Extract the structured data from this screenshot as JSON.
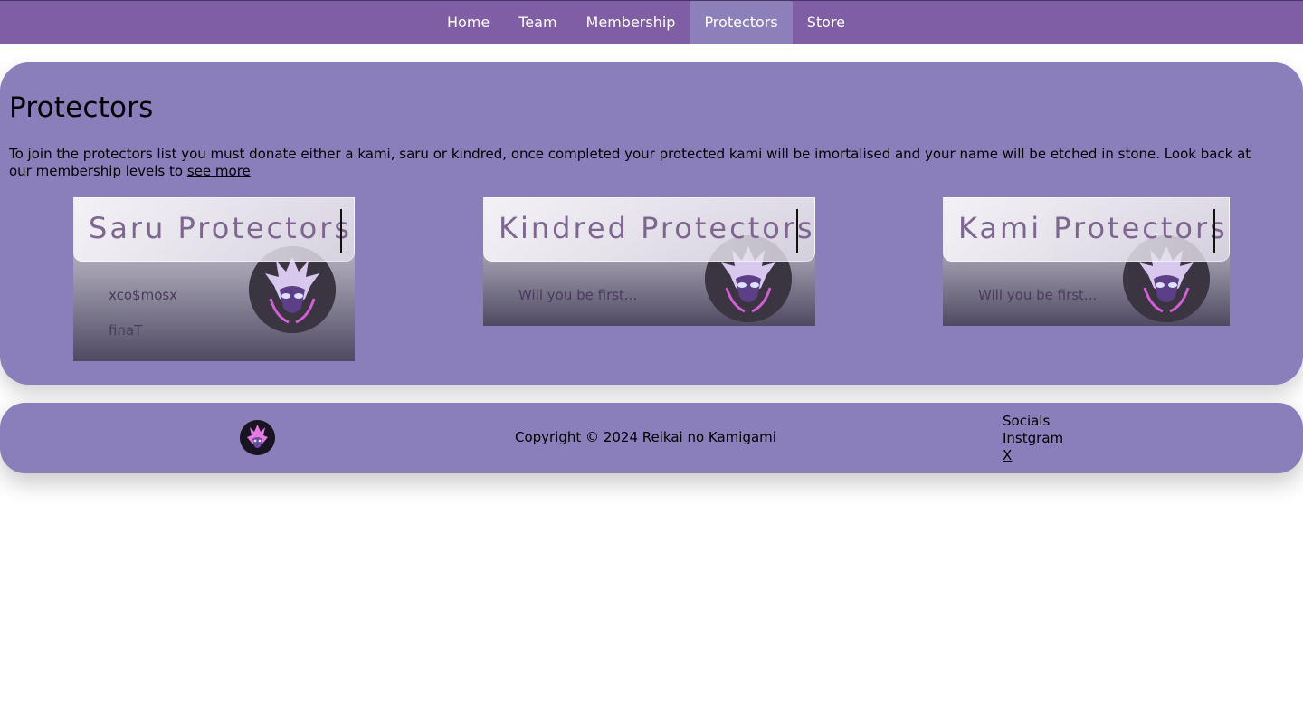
{
  "nav": {
    "items": [
      {
        "label": "Home",
        "active": false
      },
      {
        "label": "Team",
        "active": false
      },
      {
        "label": "Membership",
        "active": false
      },
      {
        "label": "Protectors",
        "active": true
      },
      {
        "label": "Store",
        "active": false
      }
    ]
  },
  "main": {
    "title": "Protectors",
    "intro": "To join the protectors list you must donate either a kami, saru or kindred, once completed your protected kami will be imortalised and your name will be etched in stone. Look back at our membership levels to ",
    "intro_link": "see more"
  },
  "cards": [
    {
      "title": "Saru Protectors",
      "members": [
        "xco$mosx",
        "finaT"
      ],
      "avatar_icon": "kami-avatar-icon"
    },
    {
      "title": "Kindred Protectors",
      "members": [
        "Will you be first..."
      ],
      "avatar_icon": "kami-avatar-icon"
    },
    {
      "title": "Kami Protectors",
      "members": [
        "Will you be first..."
      ],
      "avatar_icon": "kami-avatar-icon"
    }
  ],
  "footer": {
    "logo_icon": "reikai-logo-icon",
    "copyright": "Copyright © 2024 Reikai no Kamigami",
    "socials_heading": "Socials",
    "links": [
      "Instgram",
      "X"
    ]
  },
  "colors": {
    "nav_bg": "#7f5ea6",
    "nav_active": "#8c7fba",
    "panel_bg": "#8a7fba",
    "card_title": "#7e6691"
  }
}
